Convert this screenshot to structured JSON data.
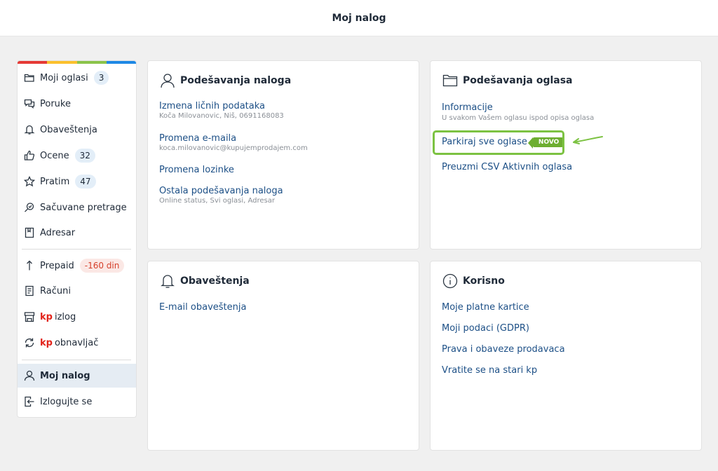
{
  "header": {
    "title": "Moj nalog"
  },
  "stripe_colors": [
    "#e53935",
    "#fbc02d",
    "#8bc34a",
    "#1e88e5"
  ],
  "sidebar": {
    "items": [
      {
        "label": "Moji oglasi",
        "icon": "folder-icon",
        "badge": "3"
      },
      {
        "label": "Poruke",
        "icon": "chat-icon"
      },
      {
        "label": "Obaveštenja",
        "icon": "bell-icon"
      },
      {
        "label": "Ocene",
        "icon": "thumbs-up-icon",
        "badge": "32"
      },
      {
        "label": "Pratim",
        "icon": "star-icon",
        "badge": "47"
      },
      {
        "label": "Sačuvane pretrage",
        "icon": "saved-search-icon"
      },
      {
        "label": "Adresar",
        "icon": "address-book-icon"
      },
      {
        "label": "Prepaid",
        "icon": "arrow-up-icon",
        "badge": "-160 din"
      },
      {
        "label": "Računi",
        "icon": "receipt-icon"
      },
      {
        "label": "izlog",
        "icon": "storefront-icon",
        "kp": "kp"
      },
      {
        "label": "obnavljač",
        "icon": "refresh-icon",
        "kp": "kp"
      },
      {
        "label": "Moj nalog",
        "icon": "user-icon",
        "active": true
      },
      {
        "label": "Izlogujte se",
        "icon": "logout-icon"
      }
    ]
  },
  "account_settings": {
    "title": "Podešavanja naloga",
    "personal_data": {
      "label": "Izmena ličnih podataka",
      "sub": "Koča Milovanovic, Niš, 0691168083"
    },
    "email": {
      "label": "Promena e-maila",
      "sub": "koca.milovanovic@kupujemprodajem.com"
    },
    "password": {
      "label": "Promena lozinke"
    },
    "other": {
      "label": "Ostala podešavanja naloga",
      "sub": "Online status, Svi oglasi, Adresar"
    }
  },
  "ad_settings": {
    "title": "Podešavanja oglasa",
    "info": {
      "label": "Informacije",
      "sub": "U svakom Vašem oglasu ispod opisa oglasa"
    },
    "park": {
      "label": "Parkiraj sve oglase",
      "badge": "NOVO"
    },
    "csv": {
      "label": "Preuzmi CSV Aktivnih oglasa"
    },
    "highlight_color": "#7cc242"
  },
  "notifications": {
    "title": "Obaveštenja",
    "email": {
      "label": "E-mail obaveštenja"
    }
  },
  "useful": {
    "title": "Korisno",
    "links": [
      "Moje platne kartice",
      "Moji podaci (GDPR)",
      "Prava i obaveze prodavaca",
      "Vratite se na stari kp"
    ]
  }
}
